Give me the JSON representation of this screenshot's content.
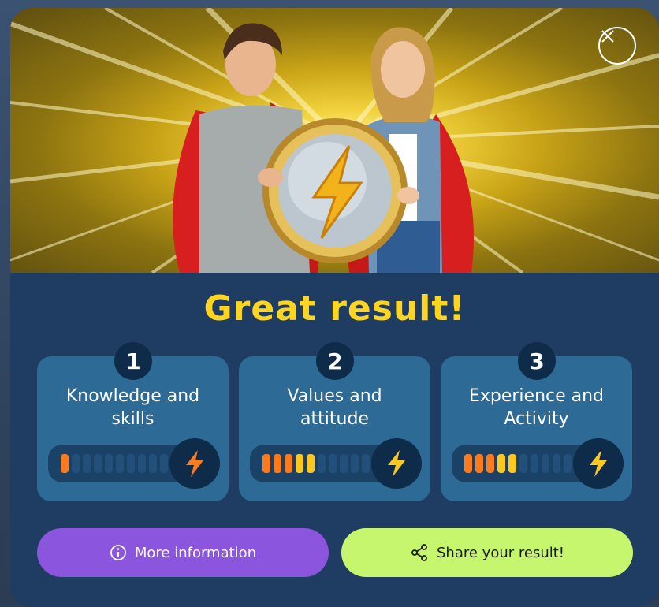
{
  "dialog": {
    "title": "Great result!",
    "close_icon": "close-icon",
    "hero_image": "two-teens-in-capes-holding-lightning-shield"
  },
  "cards": [
    {
      "number": "1",
      "label_line1": "Knowledge and",
      "label_line2": "skills",
      "level": 1,
      "of": 10,
      "bolt_color": "#ff7a1a"
    },
    {
      "number": "2",
      "label_line1": "Values and",
      "label_line2": "attitude",
      "level": 5,
      "of": 10,
      "bolt_color": "#ffc81f"
    },
    {
      "number": "3",
      "label_line1": "Experience and",
      "label_line2": "Activity",
      "level": 5,
      "of": 10,
      "bolt_color": "#ffc81f"
    }
  ],
  "buttons": {
    "more_info": {
      "label": "More information",
      "icon": "info-icon"
    },
    "share": {
      "label": "Share your result!",
      "icon": "share-icon"
    }
  },
  "colors": {
    "title": "#ffd51f",
    "panel": "#1f3d63",
    "card": "#2d6a96",
    "info_button": "#8b55dd",
    "share_button": "#c6f56e"
  }
}
